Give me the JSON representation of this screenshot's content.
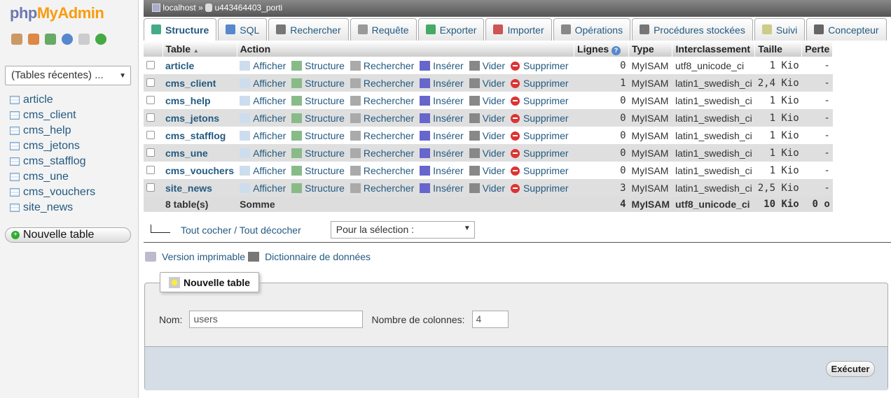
{
  "logo": {
    "php": "php",
    "myadmin": "MyAdmin"
  },
  "nav_icons": [
    "home-icon",
    "exit-icon",
    "query-icon",
    "docs-icon",
    "copy-icon",
    "reload-icon"
  ],
  "recent": {
    "label": "(Tables récentes) ..."
  },
  "tree": [
    "article",
    "cms_client",
    "cms_help",
    "cms_jetons",
    "cms_stafflog",
    "cms_une",
    "cms_vouchers",
    "site_news"
  ],
  "new_table_nav": "Nouvelle table",
  "breadcrumb": {
    "server": "localhost",
    "sep": "»",
    "db": "u443464403_porti"
  },
  "tabs": [
    {
      "label": "Structure",
      "icon": "structure-icon",
      "active": true
    },
    {
      "label": "SQL",
      "icon": "sql-icon"
    },
    {
      "label": "Rechercher",
      "icon": "search-icon"
    },
    {
      "label": "Requête",
      "icon": "query-icon"
    },
    {
      "label": "Exporter",
      "icon": "export-icon"
    },
    {
      "label": "Importer",
      "icon": "import-icon"
    },
    {
      "label": "Opérations",
      "icon": "wrench-icon"
    },
    {
      "label": "Procédures stockées",
      "icon": "procedures-icon"
    },
    {
      "label": "Suivi",
      "icon": "eye-icon"
    },
    {
      "label": "Concepteur",
      "icon": "designer-icon"
    }
  ],
  "table": {
    "headers": {
      "table": "Table",
      "sort": "▲",
      "action": "Action",
      "lignes": "Lignes",
      "type": "Type",
      "interclassement": "Interclassement",
      "taille": "Taille",
      "perte": "Perte"
    },
    "actions": {
      "afficher": "Afficher",
      "structure": "Structure",
      "rechercher": "Rechercher",
      "inserer": "Insérer",
      "vider": "Vider",
      "supprimer": "Supprimer"
    },
    "rows": [
      {
        "name": "article",
        "lignes": "0",
        "type": "MyISAM",
        "coll": "utf8_unicode_ci",
        "taille": "1 Kio",
        "perte": "-"
      },
      {
        "name": "cms_client",
        "lignes": "1",
        "type": "MyISAM",
        "coll": "latin1_swedish_ci",
        "taille": "2,4 Kio",
        "perte": "-"
      },
      {
        "name": "cms_help",
        "lignes": "0",
        "type": "MyISAM",
        "coll": "latin1_swedish_ci",
        "taille": "1 Kio",
        "perte": "-"
      },
      {
        "name": "cms_jetons",
        "lignes": "0",
        "type": "MyISAM",
        "coll": "latin1_swedish_ci",
        "taille": "1 Kio",
        "perte": "-"
      },
      {
        "name": "cms_stafflog",
        "lignes": "0",
        "type": "MyISAM",
        "coll": "latin1_swedish_ci",
        "taille": "1 Kio",
        "perte": "-"
      },
      {
        "name": "cms_une",
        "lignes": "0",
        "type": "MyISAM",
        "coll": "latin1_swedish_ci",
        "taille": "1 Kio",
        "perte": "-"
      },
      {
        "name": "cms_vouchers",
        "lignes": "0",
        "type": "MyISAM",
        "coll": "latin1_swedish_ci",
        "taille": "1 Kio",
        "perte": "-"
      },
      {
        "name": "site_news",
        "lignes": "3",
        "type": "MyISAM",
        "coll": "latin1_swedish_ci",
        "taille": "2,5 Kio",
        "perte": "-"
      }
    ],
    "footer": {
      "count": "8 table(s)",
      "somme": "Somme",
      "lignes": "4",
      "type": "MyISAM",
      "coll": "utf8_unicode_ci",
      "taille": "10 Kio",
      "perte": "0 o"
    }
  },
  "selection": {
    "toggle": "Tout cocher / Tout décocher",
    "select": "Pour la sélection :"
  },
  "links": {
    "print": "Version imprimable",
    "dict": "Dictionnaire de données"
  },
  "create": {
    "legend": "Nouvelle table",
    "name_label": "Nom:",
    "name_value": "users",
    "cols_label": "Nombre de colonnes:",
    "cols_value": "4",
    "submit": "Exécuter"
  }
}
